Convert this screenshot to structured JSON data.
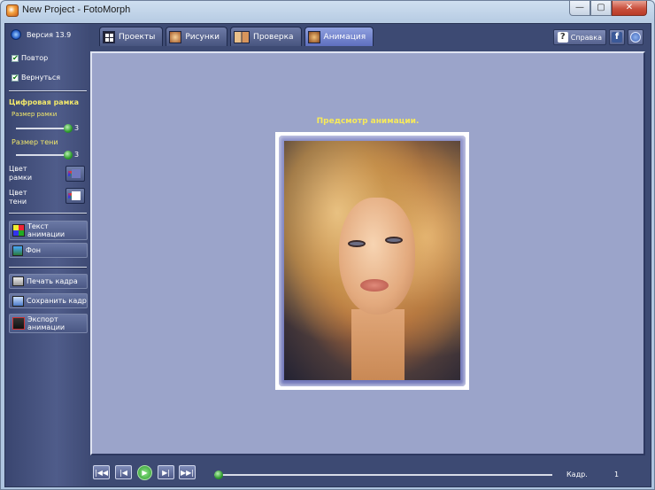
{
  "window": {
    "title": "New Project - FotoMorph",
    "min": "—",
    "max": "▢",
    "close": "✕"
  },
  "version": "Версия 13.9",
  "options": {
    "repeat": "Повтор",
    "return": "Вернуться",
    "check": "✔"
  },
  "digital_frame": {
    "heading": "Цифровая рамка",
    "frame_size_label": "Размер рамки",
    "frame_size_value": "3",
    "shadow_size_label": "Размер тени",
    "shadow_size_value": "3",
    "frame_color_label_1": "Цвет",
    "frame_color_label_2": "рамки",
    "shadow_color_label_1": "Цвет",
    "shadow_color_label_2": "тени"
  },
  "buttons": {
    "text_anim_1": "Текст",
    "text_anim_2": "анимации",
    "background": "Фон",
    "print": "Печать кадра",
    "save": "Сохранить кадр",
    "export_1": "Экспорт",
    "export_2": "анимации"
  },
  "tabs": [
    {
      "label": "Проекты"
    },
    {
      "label": "Рисунки"
    },
    {
      "label": "Проверка"
    },
    {
      "label": "Анимация"
    }
  ],
  "top_right": {
    "help": "Справка",
    "question": "?",
    "facebook": "f"
  },
  "preview_title": "Предсмотр анимации.",
  "player": {
    "first": "|◀◀",
    "prev": "|◀",
    "play": "▶",
    "next": "▶|",
    "last": "▶▶|",
    "frame_label": "Кадр.",
    "frame_value": "1",
    "progress": 0
  },
  "colors": {
    "accent_yellow": "#f7ea5a",
    "panel": "#9ba4ca",
    "sidebar": "#4f5c8a"
  }
}
